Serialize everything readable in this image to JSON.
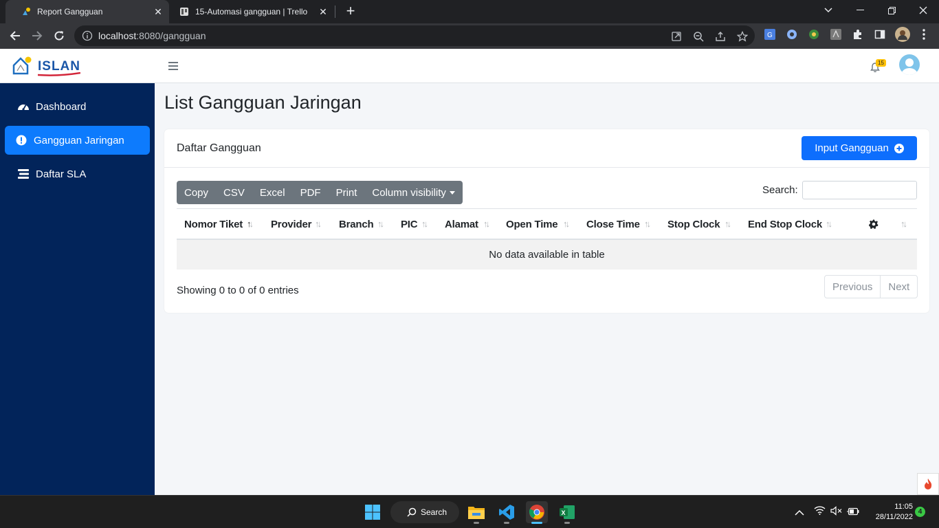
{
  "browser": {
    "tabs": [
      {
        "title": "Report Gangguan",
        "active": true
      },
      {
        "title": "15-Automasi gangguan | Trello",
        "active": false
      }
    ],
    "url_host": "localhost",
    "url_path": ":8080/gangguan"
  },
  "app": {
    "brand": "ISLAN",
    "notification_count": "15"
  },
  "sidebar": {
    "items": [
      {
        "label": "Dashboard",
        "icon": "tachometer-icon",
        "active": false
      },
      {
        "label": "Gangguan Jaringan",
        "icon": "exclamation-circle-icon",
        "active": true
      },
      {
        "label": "Daftar SLA",
        "icon": "list-icon",
        "active": false
      }
    ]
  },
  "main": {
    "page_title": "List Gangguan Jaringan",
    "card_title": "Daftar Gangguan",
    "input_button": "Input Gangguan",
    "export_buttons": [
      "Copy",
      "CSV",
      "Excel",
      "PDF",
      "Print",
      "Column visibility"
    ],
    "search_label": "Search:",
    "columns": [
      "Nomor Tiket",
      "Provider",
      "Branch",
      "PIC",
      "Alamat",
      "Open Time",
      "Close Time",
      "Stop Clock",
      "End Stop Clock"
    ],
    "empty_message": "No data available in table",
    "info": "Showing 0 to 0 of 0 entries",
    "pager": {
      "previous": "Previous",
      "next": "Next"
    }
  },
  "taskbar": {
    "search_label": "Search",
    "time": "11:05",
    "date": "28/11/2022",
    "notification_count": "4"
  },
  "colors": {
    "sidebar": "#02245a",
    "primary": "#0d6efd",
    "active_nav": "#0d7bfd"
  }
}
